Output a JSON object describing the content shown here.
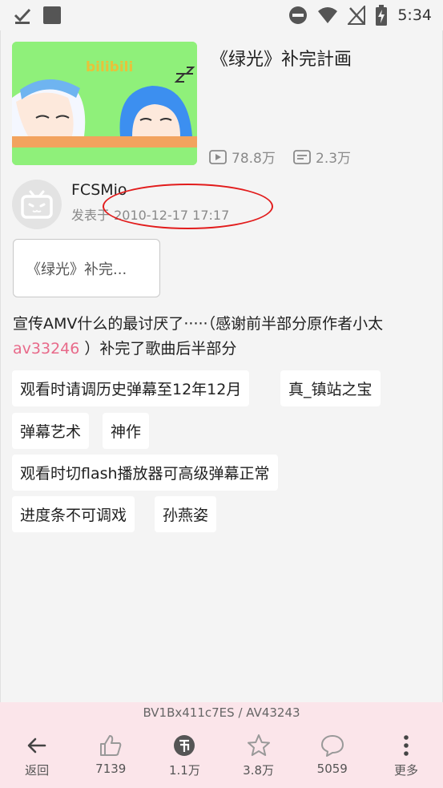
{
  "status_bar": {
    "time": "5:34",
    "left_icons": [
      "download-check-icon",
      "square-app-icon"
    ],
    "right_icons": [
      "dnd-icon",
      "wifi-icon",
      "no-signal-icon",
      "battery-charging-icon"
    ]
  },
  "video": {
    "title": "《绿光》补完計画",
    "thumb_logo": "bilibili",
    "views": "78.8万",
    "danmaku": "2.3万"
  },
  "uploader": {
    "name": "FCSMio",
    "published": "发表于 2010-12-17 17:17"
  },
  "part_button": "《绿光》补完...",
  "description": {
    "before": "宣传AMV什么的最讨厌了·····（感谢前半部分原作者小太 ",
    "av_link": "av33246",
    "after": " ）补完了歌曲后半部分"
  },
  "tags": [
    "观看时请调历史弹幕至12年12月",
    "真_镇站之宝",
    "弹幕艺术",
    "神作",
    "观看时切flash播放器可高级弹幕正常",
    "进度条不可调戏",
    "孙燕姿"
  ],
  "bottom_bar": {
    "ids": "BV1Bx411c7ES / AV43243",
    "actions": [
      {
        "label": "返回",
        "icon": "back-arrow-icon"
      },
      {
        "label": "7139",
        "icon": "thumb-up-icon"
      },
      {
        "label": "1.1万",
        "icon": "coin-icon"
      },
      {
        "label": "3.8万",
        "icon": "star-icon"
      },
      {
        "label": "5059",
        "icon": "comment-icon"
      },
      {
        "label": "更多",
        "icon": "more-icon"
      }
    ]
  },
  "colors": {
    "background": "#f4f4f4",
    "thumbnail_bg": "#8ff07a",
    "av_link": "#e86a8a",
    "annotation_circle": "#e21c1c",
    "bottom_bar": "#fbe5ea"
  }
}
